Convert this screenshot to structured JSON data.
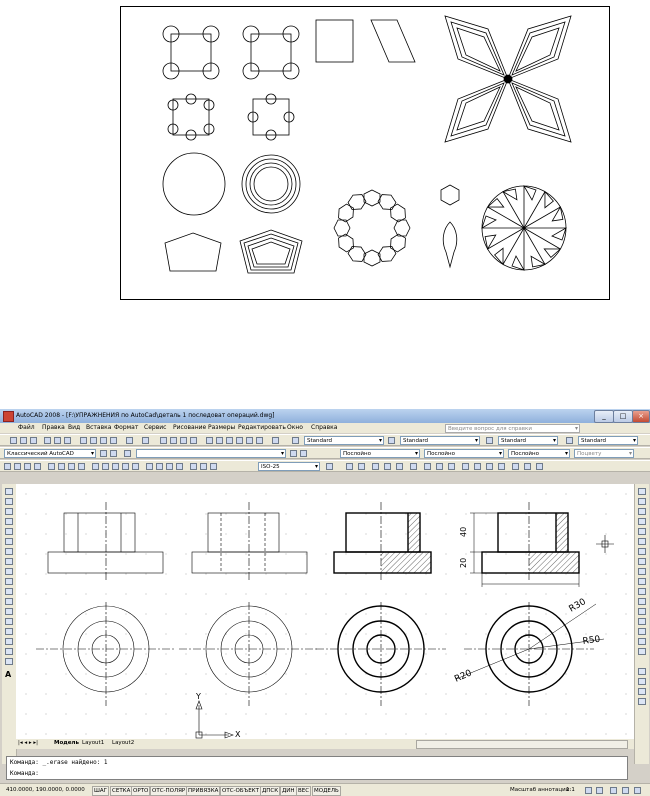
{
  "window": {
    "title": "AutoCAD 2008 - [F:\\УПРАЖНЕНИЯ по AutoCad\\деталь 1  последоват операций.dwg]",
    "help_placeholder": "Введите вопрос для справки"
  },
  "menu": [
    "Файл",
    "Правка",
    "Вид",
    "Вставка",
    "Формат",
    "Сервис",
    "Рисование",
    "Размеры",
    "Редактировать",
    "Окно",
    "Справка"
  ],
  "toolbars": {
    "text_style": "Standard",
    "dim_style": "Standard",
    "table_style": "Standard",
    "workspace": "Классический AutoCAD",
    "color": "Послойно",
    "linetype": "Послойно",
    "lineweight": "Послойно",
    "plotstyle": "Поцвету",
    "dimstyle2": "ISO-25"
  },
  "drawing": {
    "dims": [
      "40",
      "20",
      "R30",
      "R50",
      "R20"
    ],
    "ucs": {
      "x": "X",
      "y": "Y"
    }
  },
  "tabs": [
    "Модель",
    "Layout1",
    "Layout2"
  ],
  "command": {
    "line1": "Команда: _.erase найдено: 1",
    "line2": "Команда:"
  },
  "status": {
    "coords": "410.0000, 190.0000, 0.0000",
    "buttons": [
      "ШАГ",
      "СЕТКА",
      "ОРТО",
      "ОТС-ПОЛЯР",
      "ПРИВЯЗКА",
      "ОТС-ОБЪЕКТ",
      "ДПСК",
      "ДИН",
      "ВЕС",
      "МОДЕЛЬ"
    ],
    "annot_scale": "Масштаб аннотаций:",
    "scale_value": "1:1"
  },
  "colors": {
    "title_bar": "#9bb8e3",
    "ui_bg": "#ece9d8",
    "hatch": "#000000"
  }
}
